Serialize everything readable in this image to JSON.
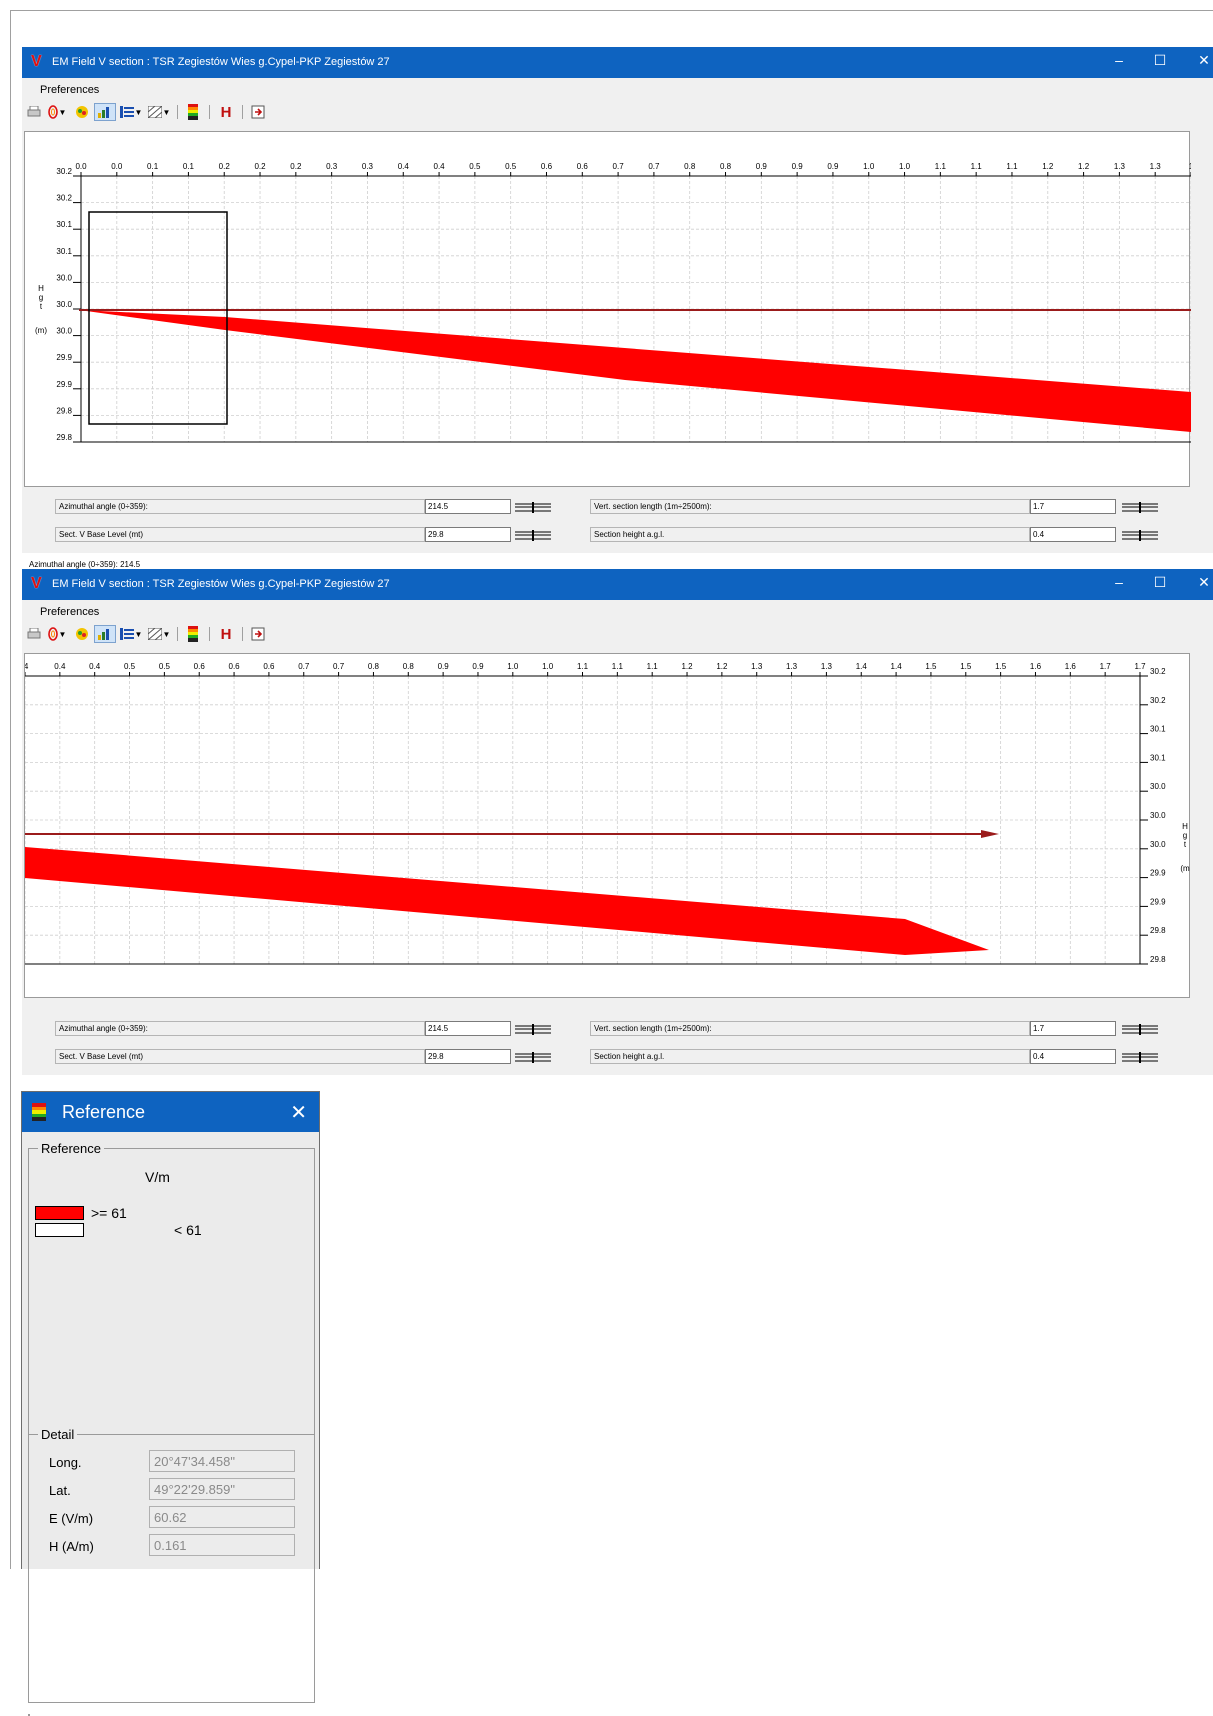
{
  "colors": {
    "accent": "#0e63c0",
    "field_fill": "#ff0000",
    "path_line": "#9b1b1b"
  },
  "windows": [
    {
      "title": "EM Field V section : TSR Zegiestów Wies g.Cypel-PKP Zegiestów 27",
      "menu": "Preferences",
      "x_ticks": [
        "0.0",
        "0.0",
        "0.1",
        "0.1",
        "0.2",
        "0.2",
        "0.2",
        "0.3",
        "0.3",
        "0.4",
        "0.4",
        "0.5",
        "0.5",
        "0.6",
        "0.6",
        "0.7",
        "0.7",
        "0.8",
        "0.8",
        "0.9",
        "0.9",
        "0.9",
        "1.0",
        "1.0",
        "1.1",
        "1.1",
        "1.1",
        "1.2",
        "1.2",
        "1.3",
        "1.3",
        "1"
      ],
      "y_ticks": [
        "30.2",
        "30.2",
        "30.1",
        "30.1",
        "30.0",
        "30.0",
        "30.0",
        "29.9",
        "29.9",
        "29.8",
        "29.8"
      ],
      "y_axis_label": [
        "H",
        "g",
        "t",
        "(m)"
      ],
      "status_text": "Azimuthal angle (0÷359): 214.5",
      "controls": {
        "azimuth_label": "Azimuthal angle (0÷359):",
        "azimuth_value": "214.5",
        "base_label": "Sect. V Base Level (mt)",
        "base_value": "29.8",
        "length_label": "Vert. section length (1m÷2500m):",
        "length_value": "1.7",
        "height_label": "Section height a.g.l.",
        "height_value": "0.4"
      }
    },
    {
      "title": "EM Field V section : TSR Zegiestów Wies g.Cypel-PKP Zegiestów 27",
      "menu": "Preferences",
      "x_ticks": [
        ".4",
        "0.4",
        "0.4",
        "0.5",
        "0.5",
        "0.6",
        "0.6",
        "0.6",
        "0.7",
        "0.7",
        "0.8",
        "0.8",
        "0.9",
        "0.9",
        "1.0",
        "1.0",
        "1.1",
        "1.1",
        "1.1",
        "1.2",
        "1.2",
        "1.3",
        "1.3",
        "1.3",
        "1.4",
        "1.4",
        "1.5",
        "1.5",
        "1.5",
        "1.6",
        "1.6",
        "1.7",
        "1.7"
      ],
      "y_ticks": [
        "30.2",
        "30.2",
        "30.1",
        "30.1",
        "30.0",
        "30.0",
        "30.0",
        "29.9",
        "29.9",
        "29.8",
        "29.8"
      ],
      "y_axis_label": [
        "H",
        "g",
        "t",
        "(m"
      ],
      "controls": {
        "azimuth_label": "Azimuthal angle (0÷359):",
        "azimuth_value": "214.5",
        "base_label": "Sect. V Base Level (mt)",
        "base_value": "29.8",
        "length_label": "Vert. section length (1m÷2500m):",
        "length_value": "1.7",
        "height_label": "Section height a.g.l.",
        "height_value": "0.4"
      }
    }
  ],
  "reference": {
    "title": "Reference",
    "group_caption": "Reference",
    "unit": "V/m",
    "legend": [
      {
        "label": ">= 61",
        "color": "#ff0000"
      },
      {
        "label": "< 61",
        "color": "#ffffff"
      }
    ],
    "detail": {
      "caption": "Detail",
      "rows": [
        {
          "label": "Long.",
          "value": "20°47'34.458\""
        },
        {
          "label": "Lat.",
          "value": "49°22'29.859\""
        },
        {
          "label": "E (V/m)",
          "value": "60.62"
        },
        {
          "label": "H (A/m)",
          "value": "0.161"
        }
      ]
    }
  }
}
